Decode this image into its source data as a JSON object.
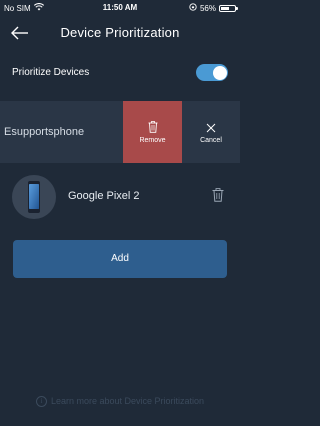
{
  "status_bar": {
    "carrier": "No SIM",
    "time": "11:50 AM",
    "battery": "56%",
    "icons": [
      "wifi-icon",
      "lock-rotation-icon",
      "battery-icon"
    ]
  },
  "header": {
    "title": "Device Prioritization",
    "back_icon": "arrow-left-icon"
  },
  "prioritize": {
    "label": "Prioritize Devices",
    "enabled": true
  },
  "swiped_device": {
    "name": "Esupportsphone",
    "remove_label": "Remove",
    "cancel_label": "Cancel",
    "remove_icon": "trash-icon",
    "cancel_icon": "close-icon"
  },
  "device": {
    "name": "Google Pixel 2",
    "icon": "phone-icon",
    "delete_icon": "trash-icon"
  },
  "add_button": {
    "label": "Add"
  },
  "footer": {
    "link_text": "Learn more about Device Prioritization",
    "icon": "info-icon",
    "info_glyph": "i"
  },
  "colors": {
    "background": "#1f2a38",
    "toggle_on": "#4a9ad4",
    "remove": "#a84a4a",
    "add_button": "#2e5e8e"
  }
}
